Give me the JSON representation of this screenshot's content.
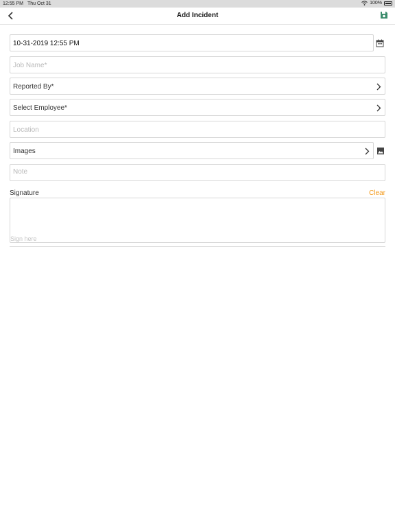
{
  "status_bar": {
    "time": "12:55 PM",
    "date": "Thu Oct 31",
    "battery": "100%"
  },
  "nav": {
    "title": "Add Incident",
    "back_icon": "chevron-left-icon",
    "save_icon": "floppy-disk-icon",
    "save_color": "#3c8c6c"
  },
  "form": {
    "datetime": "10-31-2019 12:55 PM",
    "job_name_placeholder": "Job Name*",
    "reported_by_label": "Reported By*",
    "select_employee_label": "Select Employee*",
    "location_placeholder": "Location",
    "images_label": "Images",
    "note_placeholder": "Note"
  },
  "signature": {
    "label": "Signature",
    "clear_label": "Clear",
    "hint": "Sign here",
    "clear_color": "#f39a1c"
  }
}
